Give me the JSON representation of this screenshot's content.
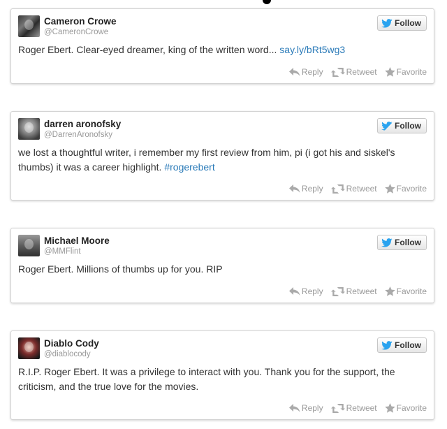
{
  "tweets": [
    {
      "name": "Cameron Crowe",
      "handle": "@CameronCrowe",
      "text": "Roger Ebert. Clear-eyed dreamer, king of the written word... ",
      "link": "say.ly/bRt5wg3",
      "follow_label": "Follow"
    },
    {
      "name": "darren aronofsky",
      "handle": "@DarrenAronofsky",
      "text": "we lost a thoughtful writer, i remember my first review from him, pi (i got his and siskel's thumbs) it was a career highlight. ",
      "link": "#rogerebert",
      "follow_label": "Follow"
    },
    {
      "name": "Michael Moore",
      "handle": "@MMFlint",
      "text": "Roger Ebert. Millions of thumbs up for you. RIP",
      "follow_label": "Follow"
    },
    {
      "name": "Diablo Cody",
      "handle": "@diablocody",
      "text": "R.I.P. Roger Ebert. It was a privilege to interact with you. Thank you for the support, the criticism, and the true love for the movies.",
      "follow_label": "Follow"
    }
  ],
  "actions": {
    "reply": "Reply",
    "retweet": "Retweet",
    "favorite": "Favorite"
  },
  "colors": {
    "link": "#2a7ab8",
    "twitter_bird": "#2aa3ef",
    "muted": "#999999"
  },
  "icons": {
    "follow": "twitter-bird-icon",
    "reply": "reply-arrow-icon",
    "retweet": "retweet-icon",
    "favorite": "star-icon"
  }
}
